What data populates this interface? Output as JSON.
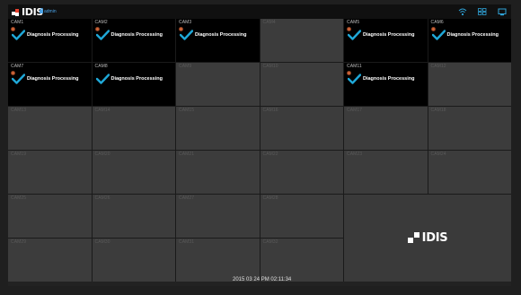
{
  "header": {
    "logo_text": "IDIS",
    "user_label": "admin"
  },
  "diagnosis_text": "Diagnosis Processing",
  "cells": [
    {
      "label": "CAM1"
    },
    {
      "label": "CAM2"
    },
    {
      "label": "CAM3"
    },
    {
      "label": "CAM4"
    },
    {
      "label": "CAM5"
    },
    {
      "label": "CAM6"
    },
    {
      "label": "CAM7"
    },
    {
      "label": "CAM8"
    },
    {
      "label": "CAM9"
    },
    {
      "label": "CAM10"
    },
    {
      "label": "CAM11"
    },
    {
      "label": "CAM12"
    },
    {
      "label": "CAM13"
    },
    {
      "label": "CAM14"
    },
    {
      "label": "CAM15"
    },
    {
      "label": "CAM16"
    },
    {
      "label": "CAM17"
    },
    {
      "label": "CAM18"
    },
    {
      "label": "CAM19"
    },
    {
      "label": "CAM20"
    },
    {
      "label": "CAM21"
    },
    {
      "label": "CAM22"
    },
    {
      "label": "CAM23"
    },
    {
      "label": "CAM24"
    },
    {
      "label": "CAM25"
    },
    {
      "label": "CAM26"
    },
    {
      "label": "CAM27"
    },
    {
      "label": "CAM28"
    },
    {
      "label": "CAM29"
    },
    {
      "label": "CAM30"
    },
    {
      "label": "CAM31"
    },
    {
      "label": "CAM32"
    }
  ],
  "logo_cell_text": "IDIS",
  "status": {
    "datetime": "2015 03 24 PM 02:11:34"
  },
  "colors": {
    "accent": "#1fa8d8",
    "record": "#d0663a",
    "cell_active": "#000000",
    "cell_inactive": "#3c3c3c"
  }
}
